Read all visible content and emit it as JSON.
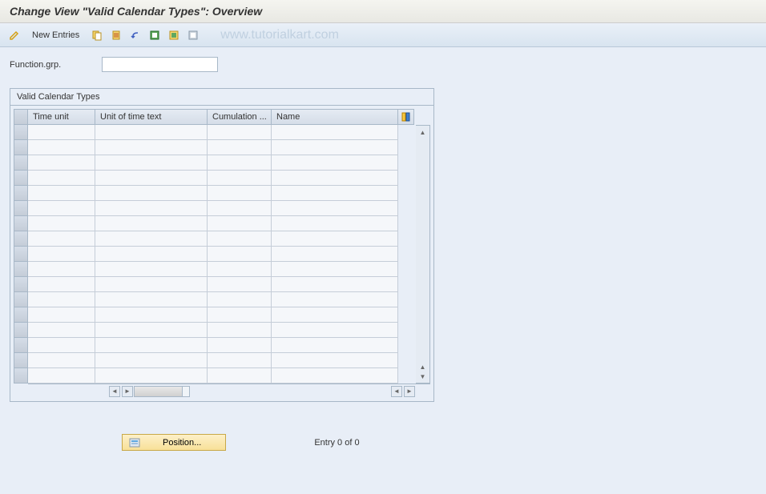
{
  "title": "Change View \"Valid Calendar Types\": Overview",
  "toolbar": {
    "new_entries": "New Entries"
  },
  "watermark": "www.tutorialkart.com",
  "field": {
    "label": "Function.grp.",
    "value": ""
  },
  "group": {
    "title": "Valid Calendar Types",
    "columns": {
      "c1": "Time unit",
      "c2": "Unit of time text",
      "c3": "Cumulation ...",
      "c4": "Name"
    }
  },
  "footer": {
    "position_label": "Position...",
    "entry_status": "Entry 0 of 0"
  }
}
